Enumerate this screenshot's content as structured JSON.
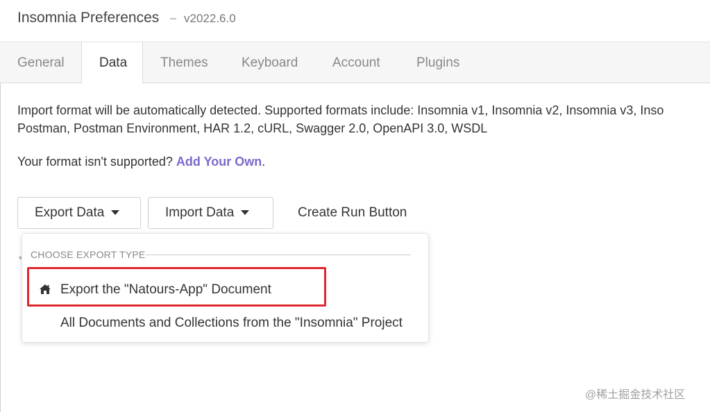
{
  "window": {
    "title": "Insomnia Preferences",
    "separator": "–",
    "version": "v2022.6.0"
  },
  "tabs": [
    {
      "label": "General"
    },
    {
      "label": "Data"
    },
    {
      "label": "Themes"
    },
    {
      "label": "Keyboard"
    },
    {
      "label": "Account"
    },
    {
      "label": "Plugins"
    }
  ],
  "active_tab": "Data",
  "content": {
    "formats_line1": "Import format will be automatically detected. Supported formats include: Insomnia v1, Insomnia v2, Insomnia v3, Inso",
    "formats_line2": "Postman, Postman Environment, HAR 1.2, cURL, Swagger 2.0, OpenAPI 3.0, WSDL",
    "unsupported_text": "Your format isn't supported?",
    "add_own_link": "Add Your Own",
    "period": "."
  },
  "buttons": {
    "export_data": "Export Data",
    "import_data": "Import Data",
    "create_run_button": "Create Run Button"
  },
  "export_dropdown": {
    "header": "CHOOSE EXPORT TYPE",
    "items": [
      {
        "label": "Export the \"Natours-App\" Document",
        "icon": "home-icon",
        "highlighted": true
      },
      {
        "label": "All Documents and Collections from the \"Insomnia\" Project",
        "icon": null,
        "highlighted": false
      }
    ]
  },
  "watermark": "@稀土掘金技术社区",
  "colors": {
    "link": "#7d69cb",
    "highlight": "#e0262f"
  }
}
